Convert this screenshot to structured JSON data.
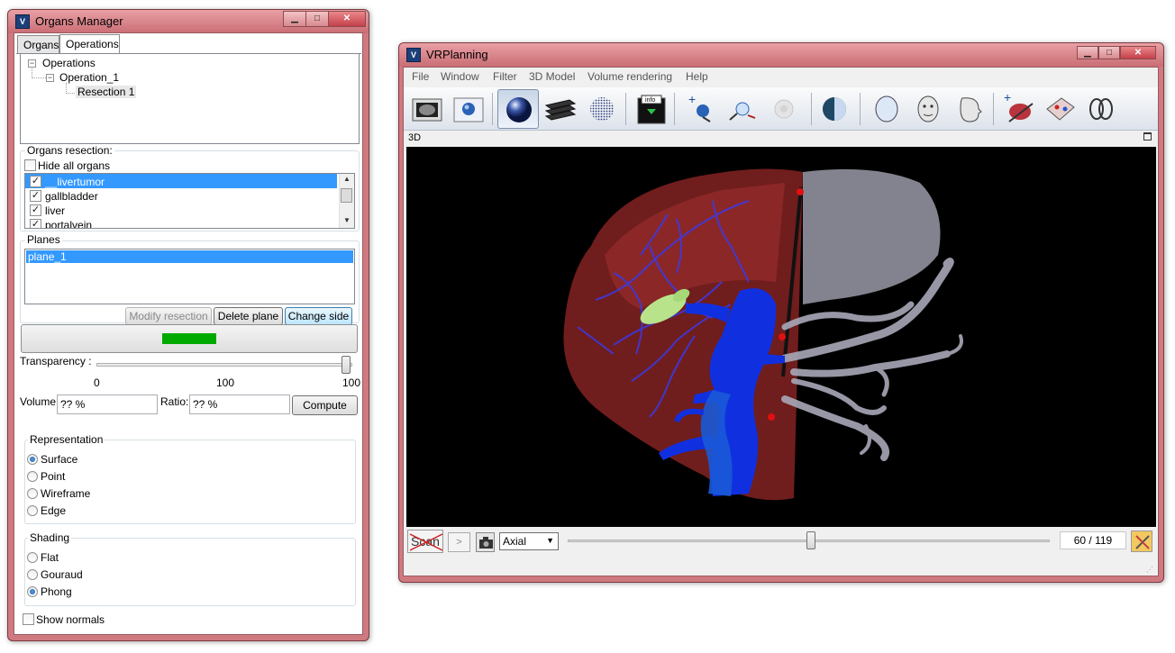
{
  "organs_manager": {
    "title": "Organs Manager",
    "tabs": [
      {
        "label": "Organs"
      },
      {
        "label": "Operations"
      }
    ],
    "tree": {
      "root": "Operations",
      "operation": "Operation_1",
      "resection": "Resection 1"
    },
    "organs_resection": {
      "title": "Organs resection:",
      "hide_all_label": "Hide all organs",
      "items": [
        {
          "label": "__livertumor",
          "checked": true,
          "selected": true
        },
        {
          "label": "gallbladder",
          "checked": true
        },
        {
          "label": "liver",
          "checked": true
        },
        {
          "label": "portalvein",
          "checked": true
        }
      ]
    },
    "planes": {
      "title": "Planes",
      "items": [
        {
          "label": "plane_1",
          "selected": true
        }
      ],
      "buttons": {
        "modify": "Modify resection",
        "delete": "Delete plane",
        "change_side": "Change side"
      }
    },
    "transparency": {
      "label": "Transparency :",
      "value": 100,
      "min_label": "0",
      "mid_label": "100",
      "max_label": "100"
    },
    "volume": {
      "label": "Volume:",
      "value": "?? %"
    },
    "ratio": {
      "label": "Ratio:",
      "value": "?? %"
    },
    "compute_label": "Compute",
    "representation": {
      "title": "Representation",
      "options": [
        {
          "label": "Surface",
          "selected": true
        },
        {
          "label": "Point"
        },
        {
          "label": "Wireframe"
        },
        {
          "label": "Edge"
        }
      ]
    },
    "shading": {
      "title": "Shading",
      "options": [
        {
          "label": "Flat"
        },
        {
          "label": "Gouraud"
        },
        {
          "label": "Phong",
          "selected": true
        }
      ]
    },
    "show_normals_label": "Show normals"
  },
  "vrplanning": {
    "title": "VRPlanning",
    "menu": [
      "File",
      "Window",
      "Filter",
      "3D Model",
      "Volume rendering",
      "Help"
    ],
    "toolbar_icons": [
      "scan-slices-icon",
      "sphere-view-icon",
      "shaded-sphere-icon",
      "stacked-slices-icon",
      "dotted-sphere-icon",
      "info-icon",
      "add-landmark-icon",
      "remove-landmark-icon",
      "disabled-landmark-icon",
      "half-sphere-icon",
      "head-outline-icon",
      "face-front-icon",
      "face-profile-icon",
      "add-resection-icon",
      "plane-tool-icon",
      "double-ring-icon"
    ],
    "view_label": "3D",
    "scan_label": "Scan",
    "orientation": "Axial",
    "slice_counter": "60 / 119",
    "slice_value": 60,
    "slice_max": 119
  },
  "colors": {
    "accent": "#3399ff",
    "progress": "#00aa00",
    "liver": "#8b2a2a",
    "vessels": "#1530e0"
  }
}
